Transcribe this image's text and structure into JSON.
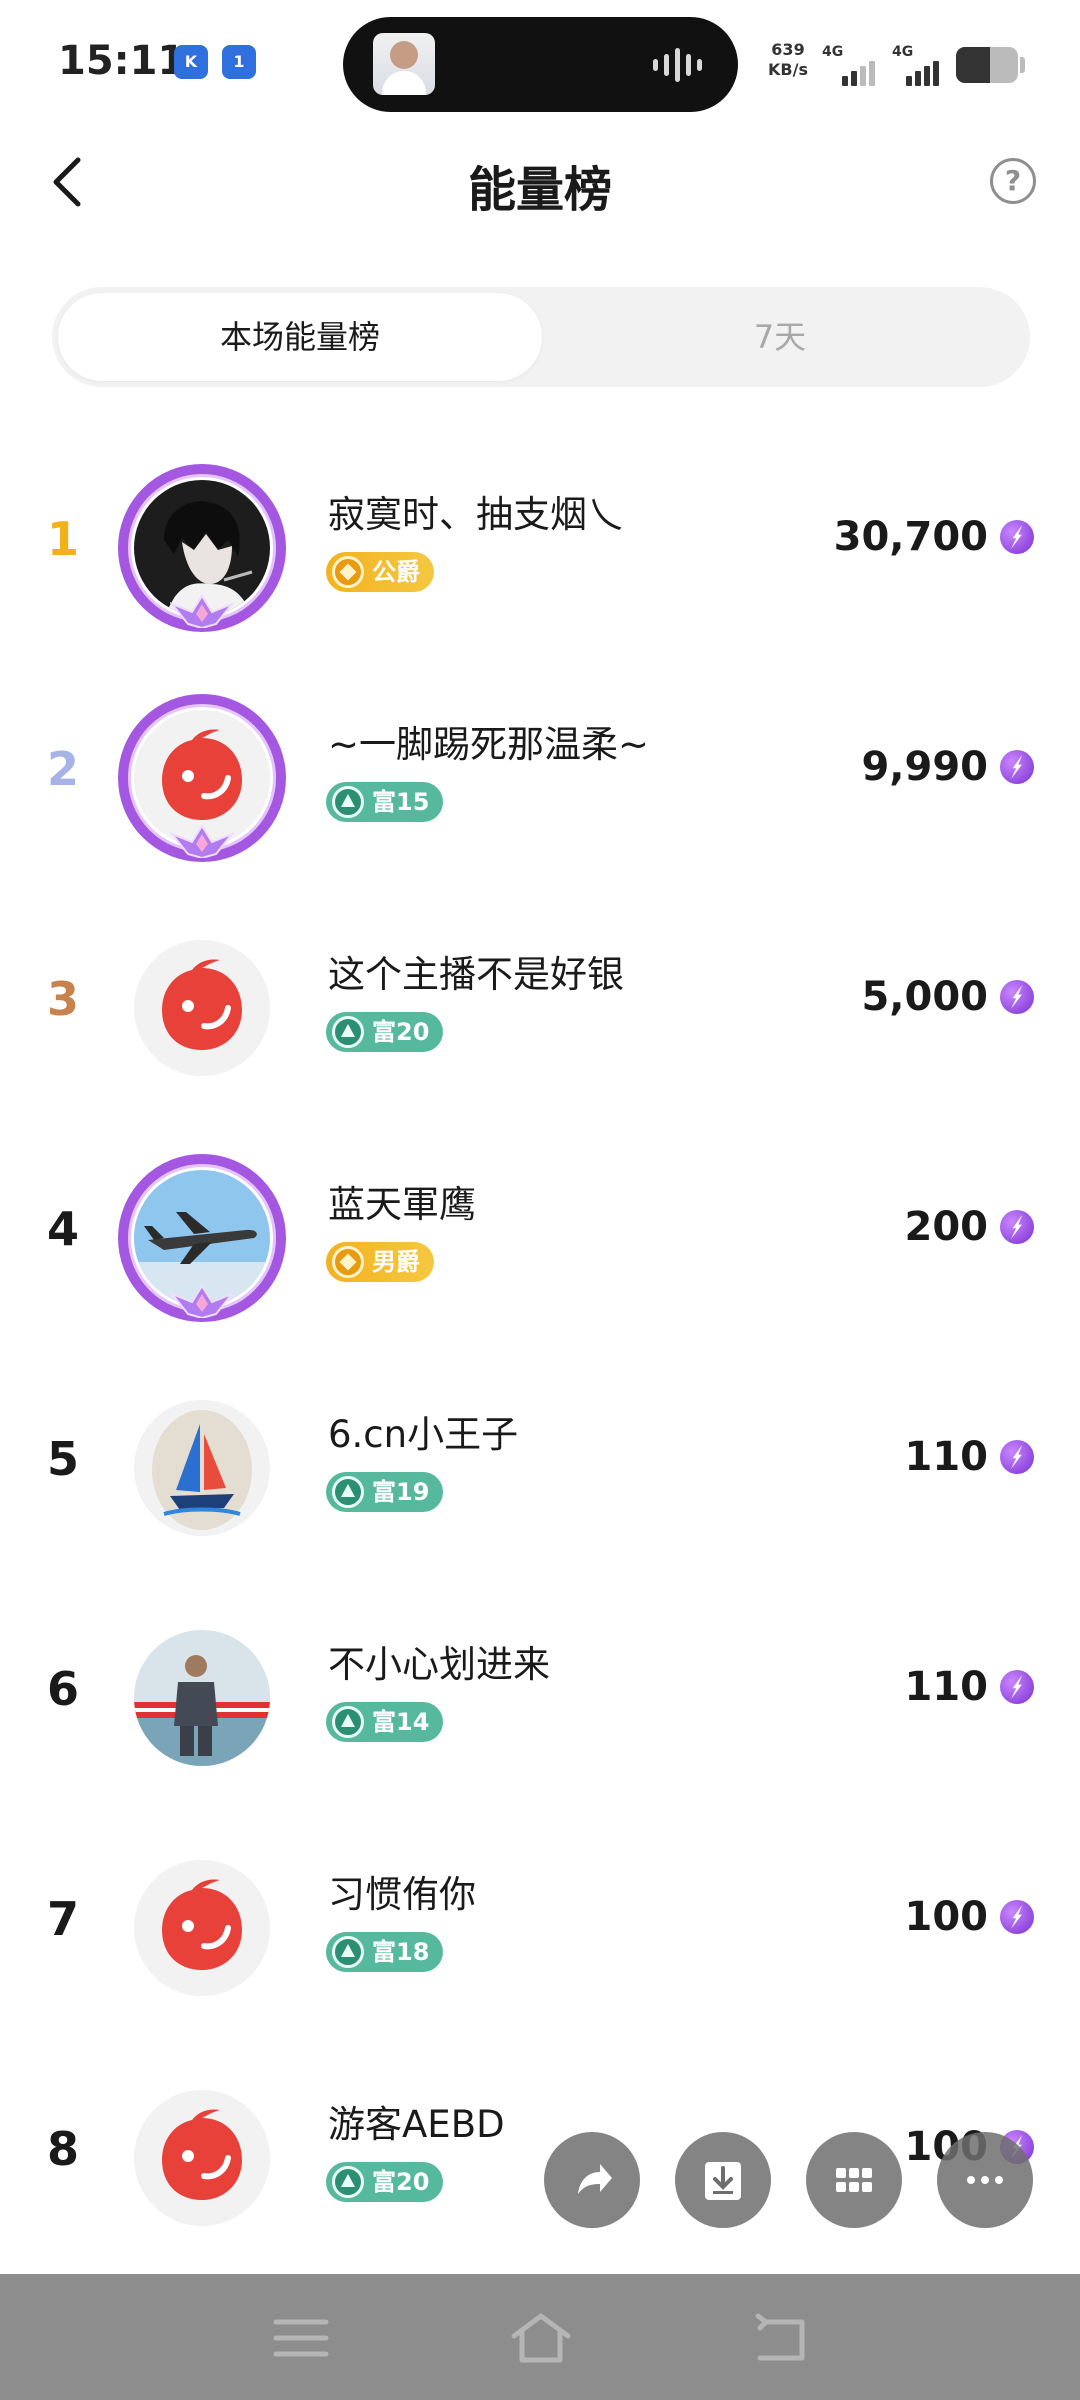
{
  "status_bar": {
    "time": "15:11",
    "app_icon_1": "K",
    "app_icon_2": "1",
    "net_speed_value": "639",
    "net_speed_unit": "KB/s",
    "signal_1_label": "4G",
    "signal_2_label": "4G",
    "battery_level_percent": 55,
    "icons": [
      "kuaishou-app-icon",
      "hotspot-icon",
      "voice-wave-icon",
      "signal-icon",
      "battery-icon"
    ]
  },
  "header": {
    "title": "能量榜",
    "back_icon": "back-arrow-icon",
    "help_label": "?"
  },
  "tabs": [
    {
      "label": "本场能量榜",
      "active": true
    },
    {
      "label": "7天",
      "active": false
    }
  ],
  "ranking": [
    {
      "rank": "1",
      "rank_color": "#f2b11a",
      "name": "寂寞时、抽支烟乀",
      "badge_type": "noble",
      "badge_label": "公爵",
      "score": "30,700",
      "avatar": "anime-boy",
      "frame": true
    },
    {
      "rank": "2",
      "rank_color": "#a7b2e6",
      "name": "~一脚踢死那温柔~",
      "badge_type": "rich",
      "badge_label": "富15",
      "score": "9,990",
      "avatar": "default-red",
      "frame": true
    },
    {
      "rank": "3",
      "rank_color": "#c8834d",
      "name": "这个主播不是好银",
      "badge_type": "rich",
      "badge_label": "富20",
      "score": "5,000",
      "avatar": "default-red",
      "frame": false
    },
    {
      "rank": "4",
      "rank_color": "#1a1a1a",
      "name": "蓝天軍鹰",
      "badge_type": "noble",
      "badge_label": "男爵",
      "score": "200",
      "avatar": "airplane",
      "frame": true
    },
    {
      "rank": "5",
      "rank_color": "#1a1a1a",
      "name": "6.cn小王子",
      "badge_type": "rich",
      "badge_label": "富19",
      "score": "110",
      "avatar": "sailboat-stone",
      "frame": false
    },
    {
      "rank": "6",
      "rank_color": "#1a1a1a",
      "name": "不小心划进来",
      "badge_type": "rich",
      "badge_label": "富14",
      "score": "110",
      "avatar": "man-photo",
      "frame": false
    },
    {
      "rank": "7",
      "rank_color": "#1a1a1a",
      "name": "习惯侑你",
      "badge_type": "rich",
      "badge_label": "富18",
      "score": "100",
      "avatar": "default-red",
      "frame": false
    },
    {
      "rank": "8",
      "rank_color": "#1a1a1a",
      "name": "游客AEBD",
      "badge_type": "rich",
      "badge_label": "富20",
      "score": "100",
      "avatar": "default-red",
      "frame": false
    }
  ],
  "floating_actions": [
    "share-icon",
    "download-icon",
    "grid-icon",
    "more-icon"
  ],
  "nav_bar": [
    "menu-icon",
    "home-icon",
    "back-icon"
  ]
}
